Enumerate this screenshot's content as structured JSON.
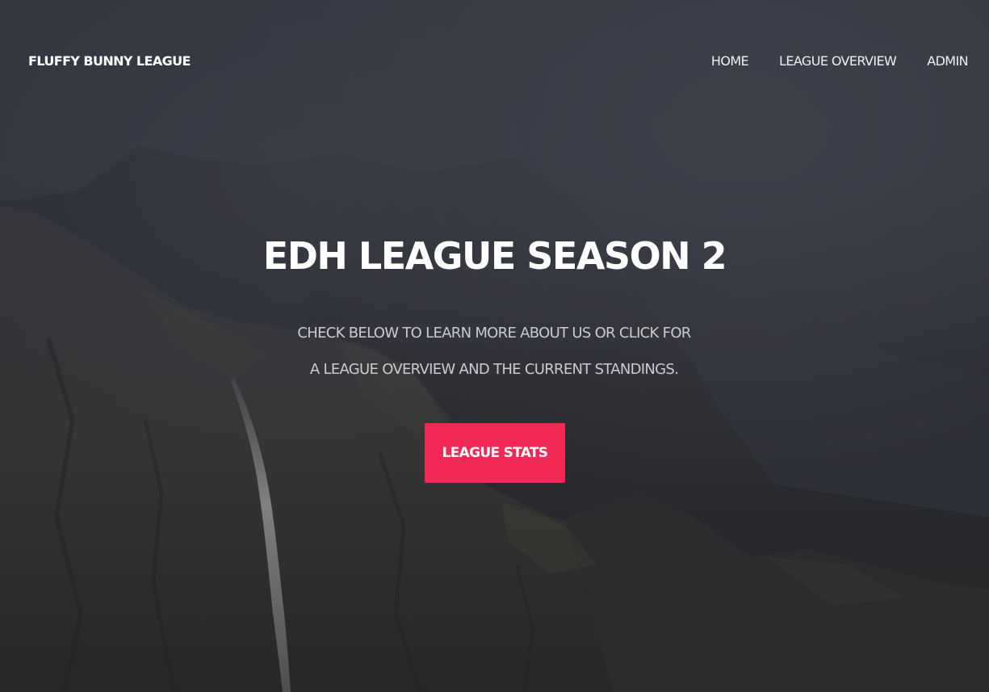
{
  "nav": {
    "brand": "FLUFFY BUNNY LEAGUE",
    "links": [
      {
        "label": "HOME"
      },
      {
        "label": "LEAGUE OVERVIEW"
      },
      {
        "label": "ADMIN"
      }
    ]
  },
  "hero": {
    "title": "EDH LEAGUE SEASON 2",
    "subtitle": "CHECK BELOW TO LEARN MORE ABOUT US OR CLICK FOR A LEAGUE OVERVIEW AND THE CURRENT STANDINGS.",
    "button_label": "LEAGUE STATS",
    "background": "misty-mountain-waterfall-photo"
  },
  "colors": {
    "accent": "#f22856",
    "text": "#ffffff",
    "subtitle": "#c9cbd1"
  }
}
